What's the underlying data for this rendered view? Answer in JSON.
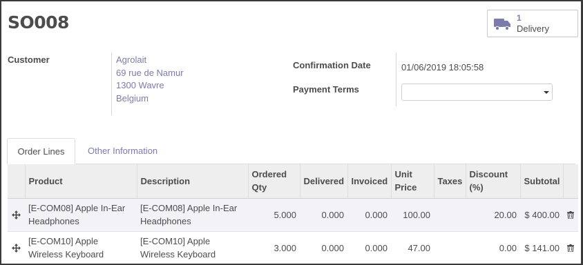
{
  "order": {
    "name": "SO008"
  },
  "stat_button": {
    "count": "1",
    "label": "Delivery",
    "icon": "truck-icon"
  },
  "customer": {
    "label": "Customer",
    "address_lines": [
      "Agrolait",
      "69 rue de Namur",
      "1300 Wavre",
      "Belgium"
    ]
  },
  "confirmation_date": {
    "label": "Confirmation Date",
    "value": "01/06/2019 18:05:58"
  },
  "payment_terms": {
    "label": "Payment Terms",
    "value": ""
  },
  "tabs": [
    {
      "label": "Order Lines",
      "active": true
    },
    {
      "label": "Other Information",
      "active": false
    }
  ],
  "order_lines": {
    "columns": [
      "",
      "Product",
      "Description",
      "Ordered Qty",
      "Delivered",
      "Invoiced",
      "Unit Price",
      "Taxes",
      "Discount (%)",
      "Subtotal",
      ""
    ],
    "rows": [
      {
        "product": "[E-COM08] Apple In-Ear Headphones",
        "description": "[E-COM08] Apple In-Ear Headphones",
        "ordered_qty": "5.000",
        "delivered": "0.000",
        "invoiced": "0.000",
        "unit_price": "100.00",
        "taxes": "",
        "discount": "20.00",
        "subtotal": "$ 400.00"
      },
      {
        "product": "[E-COM10] Apple Wireless Keyboard",
        "description": "[E-COM10] Apple Wireless Keyboard",
        "ordered_qty": "3.000",
        "delivered": "0.000",
        "invoiced": "0.000",
        "unit_price": "47.00",
        "taxes": "",
        "discount": "0.00",
        "subtotal": "$ 141.00"
      }
    ]
  },
  "colors": {
    "link": "#7c7bad",
    "text": "#4c4c4c",
    "header_bg": "#eeeeee",
    "row_highlight": "#f3f3f7"
  }
}
